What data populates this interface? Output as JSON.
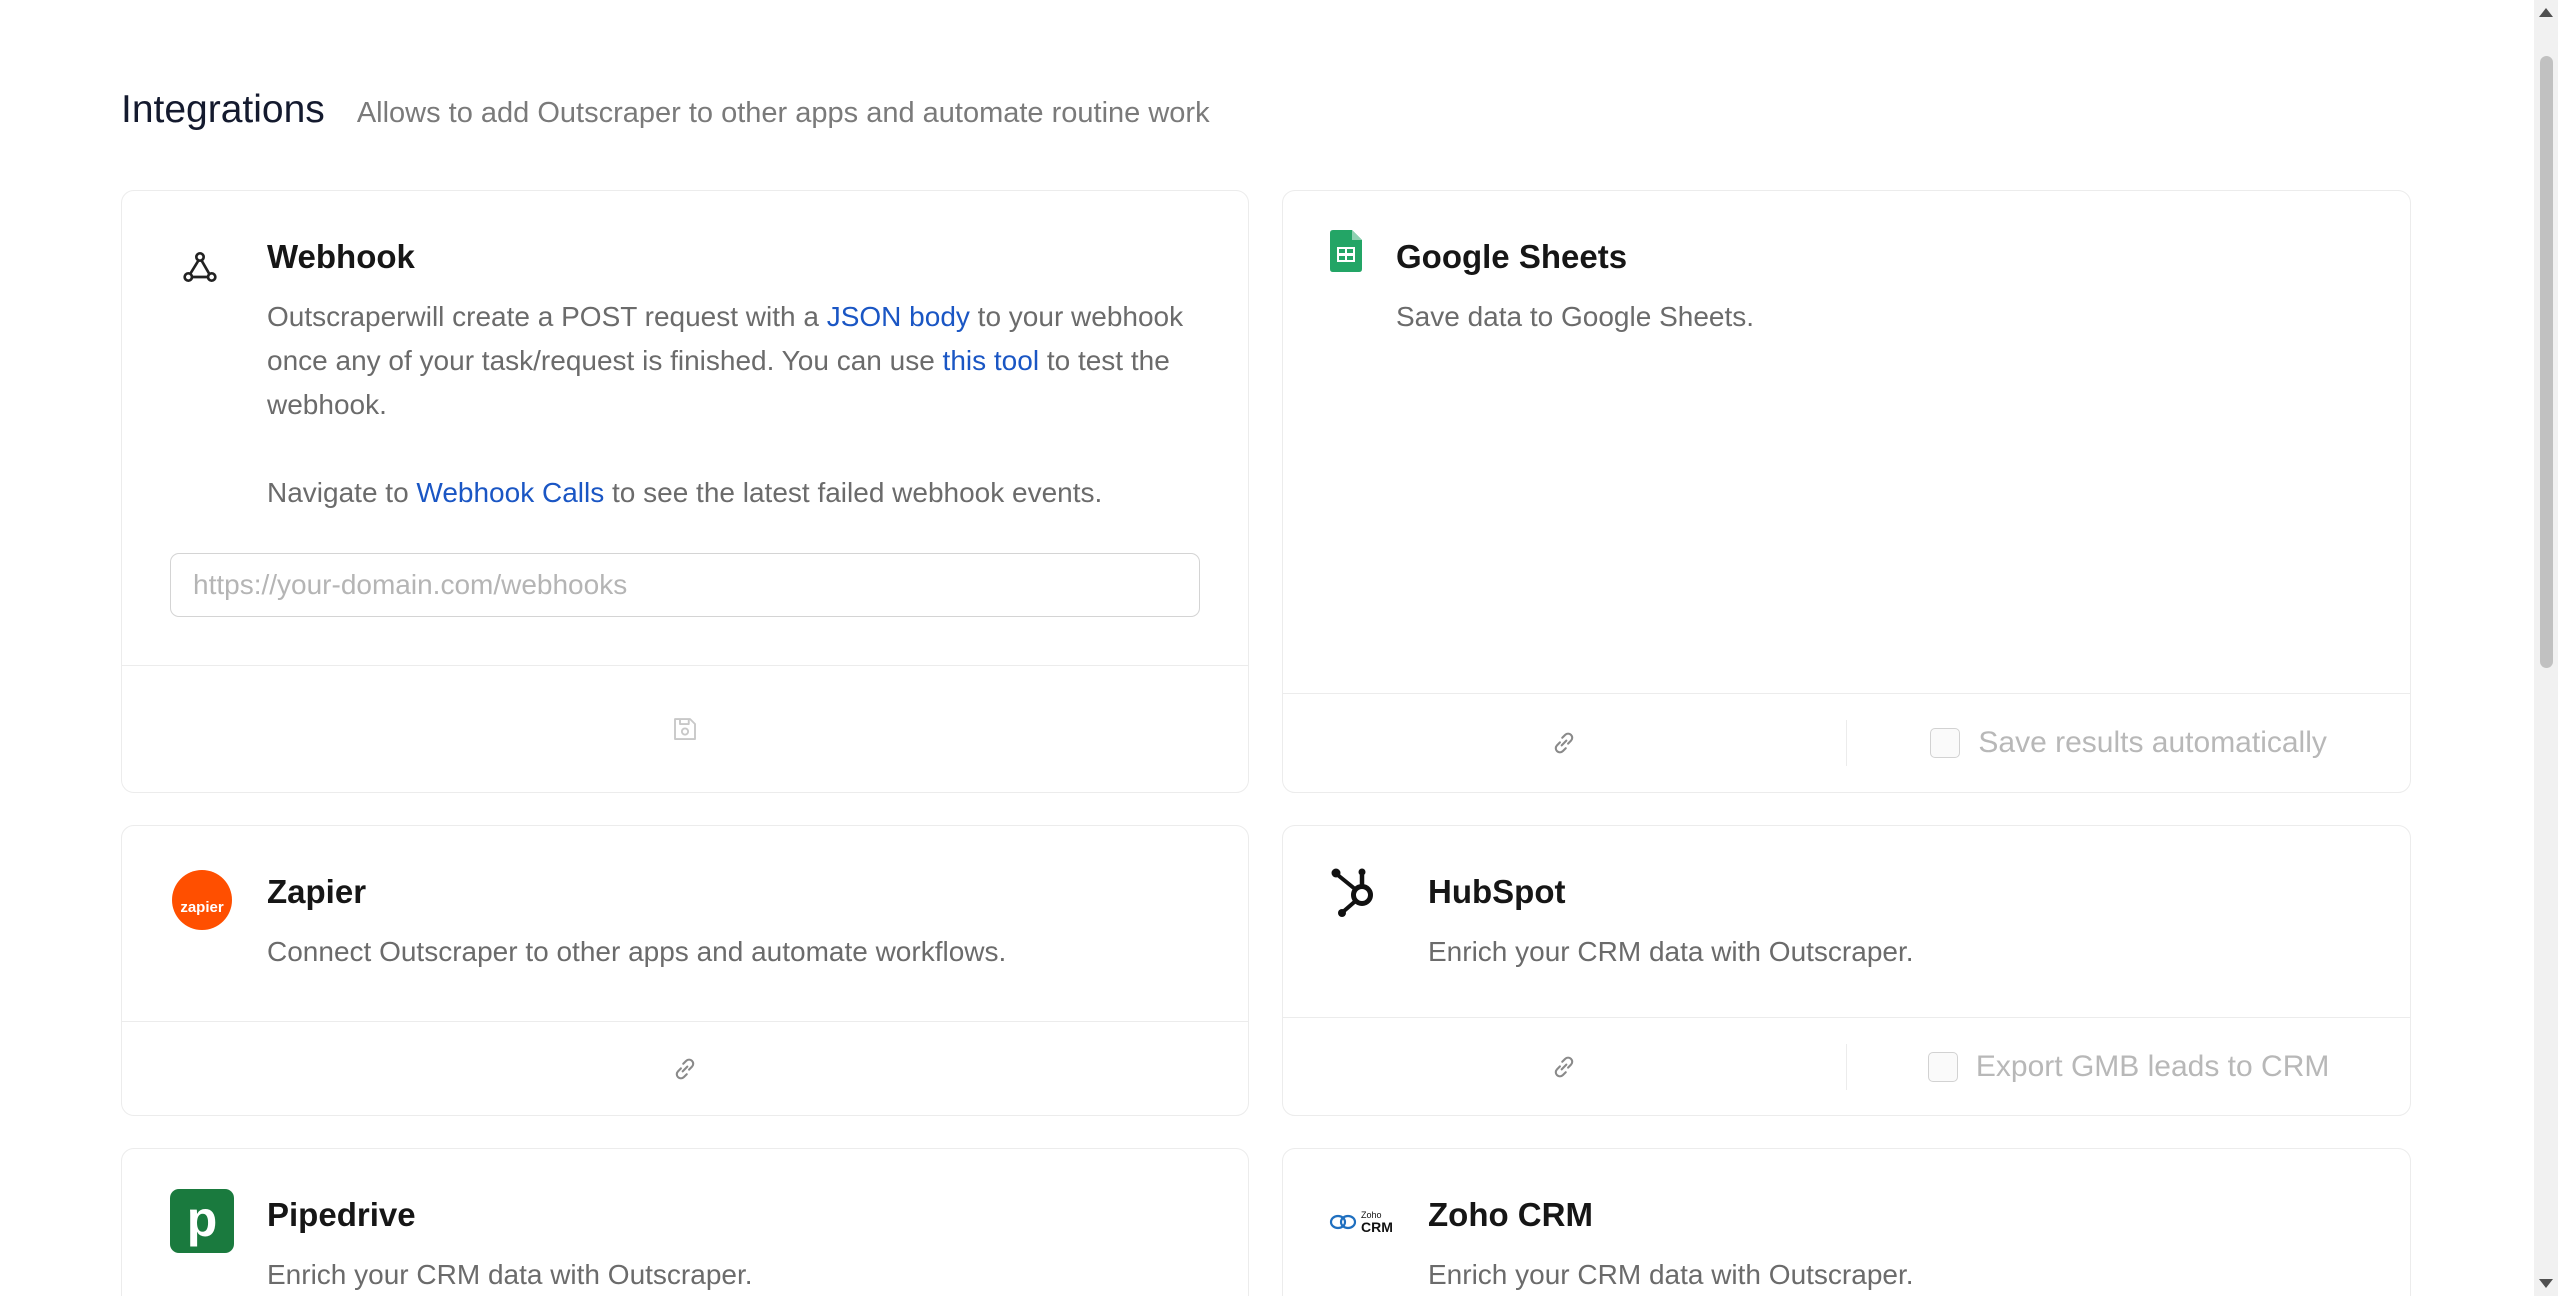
{
  "header": {
    "title": "Integrations",
    "subtitle": "Allows to add Outscraper to other apps and automate routine work"
  },
  "webhook": {
    "title": "Webhook",
    "desc_part1": "Outscraperwill create a POST request with a ",
    "link_json_body": "JSON body",
    "desc_part2": " to your webhook once any of your task/request is finished. You can use ",
    "link_this_tool": "this tool",
    "desc_part3": " to test the webhook.",
    "nav_part1": "Navigate to ",
    "link_webhook_calls": "Webhook Calls",
    "nav_part2": " to see the latest failed webhook events.",
    "input_placeholder": "https://your-domain.com/webhooks",
    "input_value": "",
    "icon": "webhook-icon",
    "save_icon": "save-icon"
  },
  "google_sheets": {
    "title": "Google Sheets",
    "desc": "Save data to Google Sheets.",
    "checkbox_label": "Save results automatically",
    "checked": false,
    "icon": "google-sheets-icon"
  },
  "zapier": {
    "title": "Zapier",
    "desc": "Connect Outscraper to other apps and automate workflows.",
    "logo_text": "zapier",
    "icon": "zapier-logo"
  },
  "hubspot": {
    "title": "HubSpot",
    "desc": "Enrich your CRM data with Outscraper.",
    "checkbox_label": "Export GMB leads to CRM",
    "checked": false,
    "icon": "hubspot-logo"
  },
  "pipedrive": {
    "title": "Pipedrive",
    "desc": "Enrich your CRM data with Outscraper.",
    "logo_text": "p",
    "icon": "pipedrive-logo"
  },
  "zoho": {
    "title": "Zoho CRM",
    "desc": "Enrich your CRM data with Outscraper.",
    "logo_text_top": "Zoho",
    "logo_text_bottom": "CRM",
    "icon": "zoho-logo"
  },
  "colors": {
    "link": "#1a56c4",
    "zapier": "#ff4f00",
    "pipedrive": "#1a7a3e",
    "sheets": "#23a566",
    "border": "#ececec"
  }
}
